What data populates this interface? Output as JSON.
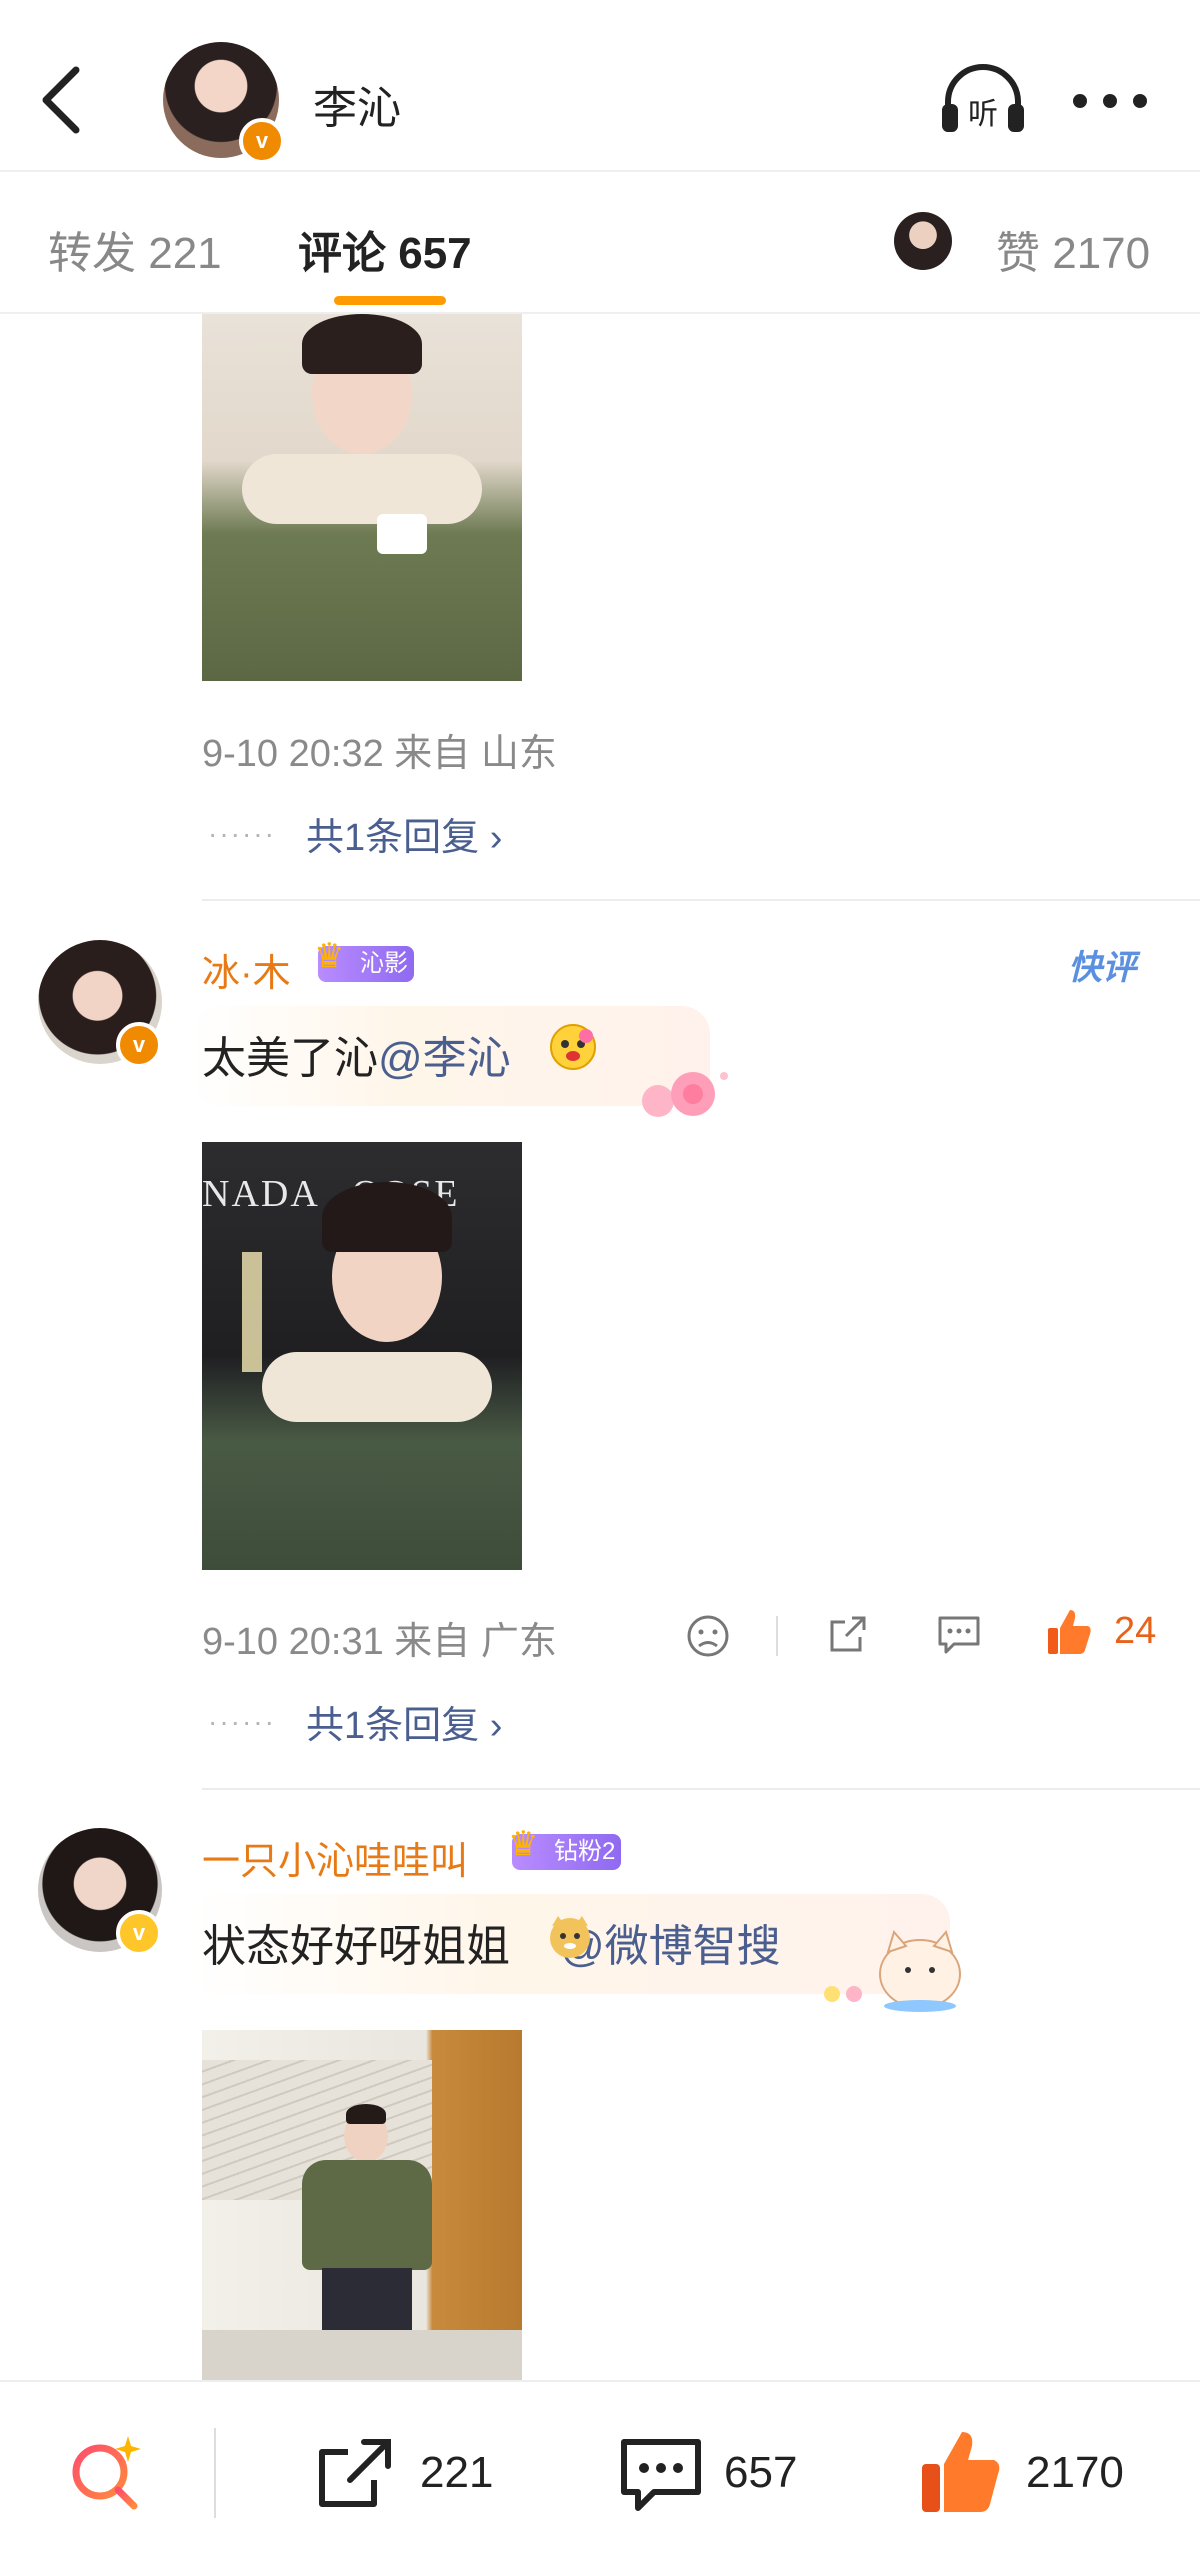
{
  "header": {
    "author_name": "李沁",
    "listen_label": "听"
  },
  "tabs": {
    "repost_label": "转发 221",
    "comment_label": "评论 657",
    "like_label": "赞 2170"
  },
  "comments": [
    {
      "meta": "9-10 20:32  来自 山东",
      "reply_link": "共1条回复 ›"
    },
    {
      "username": "冰·木",
      "badge": "沁影",
      "quick_label": "快评",
      "text_plain": "太美了沁",
      "mention": "@李沁",
      "meta": "9-10 20:31  来自 广东",
      "likes": "24",
      "reply_link": "共1条回复 ›"
    },
    {
      "username": "一只小沁哇哇叫",
      "badge": "钻粉2",
      "text_plain": "状态好好呀姐姐",
      "mention": "@微博智搜"
    }
  ],
  "bottom_bar": {
    "repost_count": "221",
    "comment_count": "657",
    "like_count": "2170"
  },
  "colors": {
    "accent_orange": "#ff9a00",
    "username_orange": "#e87a16",
    "mention_blue": "#4a5f8f",
    "like_red": "#e8621a"
  }
}
